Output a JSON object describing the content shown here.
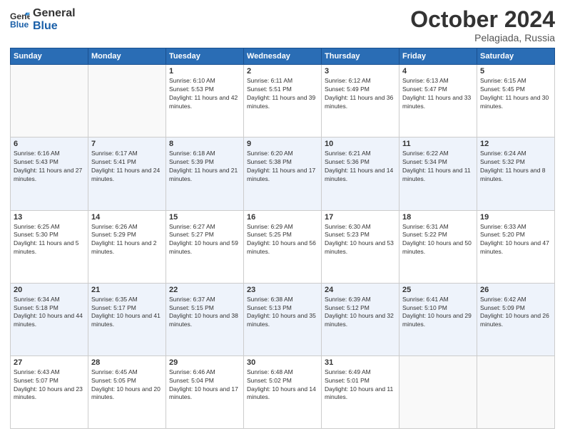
{
  "header": {
    "logo_text_general": "General",
    "logo_text_blue": "Blue",
    "month": "October 2024",
    "location": "Pelagiada, Russia"
  },
  "weekdays": [
    "Sunday",
    "Monday",
    "Tuesday",
    "Wednesday",
    "Thursday",
    "Friday",
    "Saturday"
  ],
  "weeks": [
    [
      {
        "day": "",
        "sunrise": "",
        "sunset": "",
        "daylight": ""
      },
      {
        "day": "",
        "sunrise": "",
        "sunset": "",
        "daylight": ""
      },
      {
        "day": "1",
        "sunrise": "Sunrise: 6:10 AM",
        "sunset": "Sunset: 5:53 PM",
        "daylight": "Daylight: 11 hours and 42 minutes."
      },
      {
        "day": "2",
        "sunrise": "Sunrise: 6:11 AM",
        "sunset": "Sunset: 5:51 PM",
        "daylight": "Daylight: 11 hours and 39 minutes."
      },
      {
        "day": "3",
        "sunrise": "Sunrise: 6:12 AM",
        "sunset": "Sunset: 5:49 PM",
        "daylight": "Daylight: 11 hours and 36 minutes."
      },
      {
        "day": "4",
        "sunrise": "Sunrise: 6:13 AM",
        "sunset": "Sunset: 5:47 PM",
        "daylight": "Daylight: 11 hours and 33 minutes."
      },
      {
        "day": "5",
        "sunrise": "Sunrise: 6:15 AM",
        "sunset": "Sunset: 5:45 PM",
        "daylight": "Daylight: 11 hours and 30 minutes."
      }
    ],
    [
      {
        "day": "6",
        "sunrise": "Sunrise: 6:16 AM",
        "sunset": "Sunset: 5:43 PM",
        "daylight": "Daylight: 11 hours and 27 minutes."
      },
      {
        "day": "7",
        "sunrise": "Sunrise: 6:17 AM",
        "sunset": "Sunset: 5:41 PM",
        "daylight": "Daylight: 11 hours and 24 minutes."
      },
      {
        "day": "8",
        "sunrise": "Sunrise: 6:18 AM",
        "sunset": "Sunset: 5:39 PM",
        "daylight": "Daylight: 11 hours and 21 minutes."
      },
      {
        "day": "9",
        "sunrise": "Sunrise: 6:20 AM",
        "sunset": "Sunset: 5:38 PM",
        "daylight": "Daylight: 11 hours and 17 minutes."
      },
      {
        "day": "10",
        "sunrise": "Sunrise: 6:21 AM",
        "sunset": "Sunset: 5:36 PM",
        "daylight": "Daylight: 11 hours and 14 minutes."
      },
      {
        "day": "11",
        "sunrise": "Sunrise: 6:22 AM",
        "sunset": "Sunset: 5:34 PM",
        "daylight": "Daylight: 11 hours and 11 minutes."
      },
      {
        "day": "12",
        "sunrise": "Sunrise: 6:24 AM",
        "sunset": "Sunset: 5:32 PM",
        "daylight": "Daylight: 11 hours and 8 minutes."
      }
    ],
    [
      {
        "day": "13",
        "sunrise": "Sunrise: 6:25 AM",
        "sunset": "Sunset: 5:30 PM",
        "daylight": "Daylight: 11 hours and 5 minutes."
      },
      {
        "day": "14",
        "sunrise": "Sunrise: 6:26 AM",
        "sunset": "Sunset: 5:29 PM",
        "daylight": "Daylight: 11 hours and 2 minutes."
      },
      {
        "day": "15",
        "sunrise": "Sunrise: 6:27 AM",
        "sunset": "Sunset: 5:27 PM",
        "daylight": "Daylight: 10 hours and 59 minutes."
      },
      {
        "day": "16",
        "sunrise": "Sunrise: 6:29 AM",
        "sunset": "Sunset: 5:25 PM",
        "daylight": "Daylight: 10 hours and 56 minutes."
      },
      {
        "day": "17",
        "sunrise": "Sunrise: 6:30 AM",
        "sunset": "Sunset: 5:23 PM",
        "daylight": "Daylight: 10 hours and 53 minutes."
      },
      {
        "day": "18",
        "sunrise": "Sunrise: 6:31 AM",
        "sunset": "Sunset: 5:22 PM",
        "daylight": "Daylight: 10 hours and 50 minutes."
      },
      {
        "day": "19",
        "sunrise": "Sunrise: 6:33 AM",
        "sunset": "Sunset: 5:20 PM",
        "daylight": "Daylight: 10 hours and 47 minutes."
      }
    ],
    [
      {
        "day": "20",
        "sunrise": "Sunrise: 6:34 AM",
        "sunset": "Sunset: 5:18 PM",
        "daylight": "Daylight: 10 hours and 44 minutes."
      },
      {
        "day": "21",
        "sunrise": "Sunrise: 6:35 AM",
        "sunset": "Sunset: 5:17 PM",
        "daylight": "Daylight: 10 hours and 41 minutes."
      },
      {
        "day": "22",
        "sunrise": "Sunrise: 6:37 AM",
        "sunset": "Sunset: 5:15 PM",
        "daylight": "Daylight: 10 hours and 38 minutes."
      },
      {
        "day": "23",
        "sunrise": "Sunrise: 6:38 AM",
        "sunset": "Sunset: 5:13 PM",
        "daylight": "Daylight: 10 hours and 35 minutes."
      },
      {
        "day": "24",
        "sunrise": "Sunrise: 6:39 AM",
        "sunset": "Sunset: 5:12 PM",
        "daylight": "Daylight: 10 hours and 32 minutes."
      },
      {
        "day": "25",
        "sunrise": "Sunrise: 6:41 AM",
        "sunset": "Sunset: 5:10 PM",
        "daylight": "Daylight: 10 hours and 29 minutes."
      },
      {
        "day": "26",
        "sunrise": "Sunrise: 6:42 AM",
        "sunset": "Sunset: 5:09 PM",
        "daylight": "Daylight: 10 hours and 26 minutes."
      }
    ],
    [
      {
        "day": "27",
        "sunrise": "Sunrise: 6:43 AM",
        "sunset": "Sunset: 5:07 PM",
        "daylight": "Daylight: 10 hours and 23 minutes."
      },
      {
        "day": "28",
        "sunrise": "Sunrise: 6:45 AM",
        "sunset": "Sunset: 5:05 PM",
        "daylight": "Daylight: 10 hours and 20 minutes."
      },
      {
        "day": "29",
        "sunrise": "Sunrise: 6:46 AM",
        "sunset": "Sunset: 5:04 PM",
        "daylight": "Daylight: 10 hours and 17 minutes."
      },
      {
        "day": "30",
        "sunrise": "Sunrise: 6:48 AM",
        "sunset": "Sunset: 5:02 PM",
        "daylight": "Daylight: 10 hours and 14 minutes."
      },
      {
        "day": "31",
        "sunrise": "Sunrise: 6:49 AM",
        "sunset": "Sunset: 5:01 PM",
        "daylight": "Daylight: 10 hours and 11 minutes."
      },
      {
        "day": "",
        "sunrise": "",
        "sunset": "",
        "daylight": ""
      },
      {
        "day": "",
        "sunrise": "",
        "sunset": "",
        "daylight": ""
      }
    ]
  ]
}
